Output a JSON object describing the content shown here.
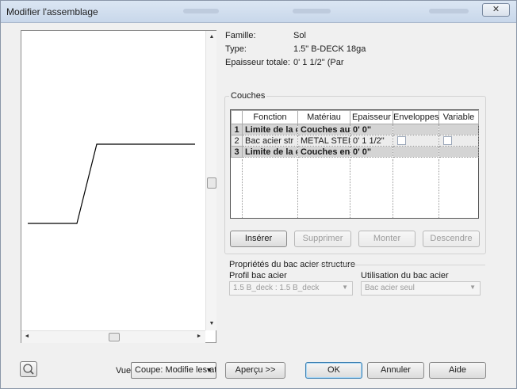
{
  "window": {
    "title": "Modifier l'assemblage",
    "close_symbol": "✕"
  },
  "info": {
    "famille_label": "Famille:",
    "famille_value": "Sol",
    "type_label": "Type:",
    "type_value": "1.5\" B-DECK 18ga",
    "epaisseur_label": "Epaisseur totale:",
    "epaisseur_value": "0'  1 1/2\" (Par"
  },
  "couches": {
    "title": "Couches",
    "columns": [
      "",
      "Fonction",
      "Matériau",
      "Epaisseur",
      "Enveloppes",
      "Variable"
    ],
    "rows": [
      {
        "num": "1",
        "fonction": "Limite de la c",
        "materiau": "Couches au-de",
        "epaisseur": "0'  0\"",
        "enveloppes": false,
        "variable": false
      },
      {
        "num": "2",
        "fonction": "Bac acier str",
        "materiau": "METAL STEE",
        "epaisseur": "0'  1 1/2\"",
        "enveloppes": true,
        "variable": true
      },
      {
        "num": "3",
        "fonction": "Limite de la c",
        "materiau": "Couches en de",
        "epaisseur": "0'  0\"",
        "enveloppes": false,
        "variable": false
      }
    ]
  },
  "buttons": {
    "inserer": "Insérer",
    "supprimer": "Supprimer",
    "monter": "Monter",
    "descendre": "Descendre",
    "apercu": "Aperçu >>",
    "ok": "OK",
    "annuler": "Annuler",
    "aide": "Aide"
  },
  "properties": {
    "title": "Propriétés du bac acier structure",
    "profil_label": "Profil bac acier",
    "profil_value": "1.5 B_deck : 1.5 B_deck",
    "utilisation_label": "Utilisation du bac acier",
    "utilisation_value": "Bac acier seul"
  },
  "view": {
    "label": "Vue:",
    "value": "Coupe: Modifie les at"
  },
  "scroll": {
    "up": "▲",
    "down": "▼",
    "left": "◄",
    "right": "►"
  },
  "icons": {
    "dropdown": "▼"
  }
}
